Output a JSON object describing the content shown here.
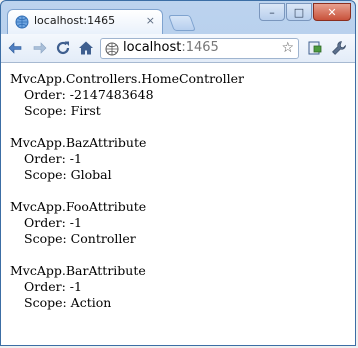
{
  "tab": {
    "title": "localhost:1465",
    "close_glyph": "×"
  },
  "window_controls": {
    "minimize": "–",
    "maximize": "□",
    "close": "✕"
  },
  "toolbar": {
    "url_host": "localhost",
    "url_port": ":1465",
    "icons": [
      "back-arrow-icon",
      "forward-arrow-icon",
      "reload-icon",
      "home-icon",
      "globe-icon",
      "star-icon",
      "page-menu-icon",
      "wrench-icon"
    ]
  },
  "entries": [
    {
      "name": "MvcApp.Controllers.HomeController",
      "order": "Order: -2147483648",
      "scope": "Scope: First"
    },
    {
      "name": "MvcApp.BazAttribute",
      "order": "Order: -1",
      "scope": "Scope: Global"
    },
    {
      "name": "MvcApp.FooAttribute",
      "order": "Order: -1",
      "scope": "Scope: Controller"
    },
    {
      "name": "MvcApp.BarAttribute",
      "order": "Order: -1",
      "scope": "Scope: Action"
    }
  ],
  "colors": {
    "accent": "#3c6ea5",
    "frame": "#a9c5e9"
  }
}
